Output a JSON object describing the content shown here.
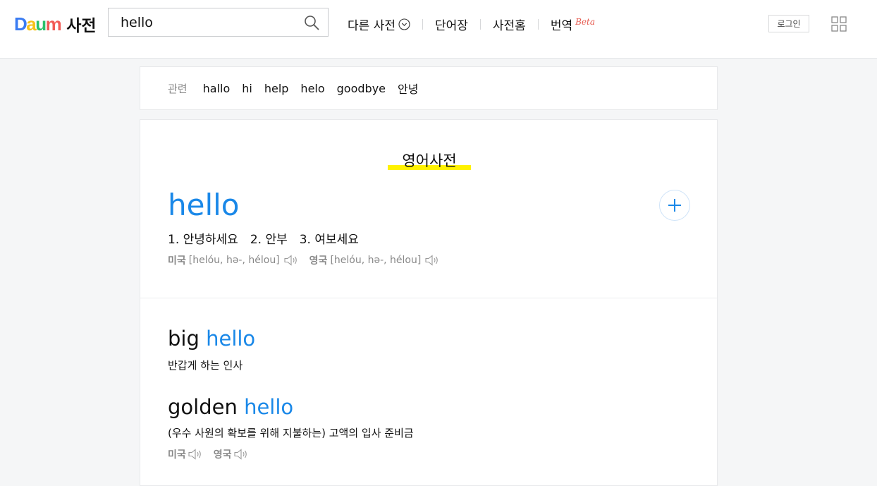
{
  "header": {
    "logo_letters": [
      "D",
      "a",
      "u",
      "m"
    ],
    "logo_text": "사전",
    "search": {
      "value": "hello",
      "placeholder": ""
    },
    "nav": [
      {
        "label": "다른 사전"
      },
      {
        "label": "단어장"
      },
      {
        "label": "사전홈"
      },
      {
        "label": "번역",
        "badge": "Beta"
      }
    ],
    "login_label": "로그인"
  },
  "related": {
    "label": "관련",
    "words": [
      "hallo",
      "hi",
      "help",
      "helo",
      "goodbye",
      "안녕"
    ]
  },
  "dictionary": {
    "section_title": "영어사전",
    "headword": "hello",
    "meanings": [
      "1. 안녕하세요",
      "2. 안부",
      "3. 여보세요"
    ],
    "pronunciations": [
      {
        "region": "미국",
        "ipa": "[helóu, hə-, hélou]"
      },
      {
        "region": "영국",
        "ipa": "[helóu, hə-, hélou]"
      }
    ],
    "examples": [
      {
        "prefix": "big ",
        "highlight": "hello",
        "meaning": "반갑게 하는 인사"
      },
      {
        "prefix": "golden ",
        "highlight": "hello",
        "meaning": "(우수 사원의 확보를 위해 지불하는) 고액의 입사 준비금",
        "pron_regions": [
          "미국",
          "영국"
        ]
      }
    ]
  },
  "colors": {
    "accent": "#1a88e8",
    "highlight": "#fff200",
    "beta": "#e6594e"
  }
}
